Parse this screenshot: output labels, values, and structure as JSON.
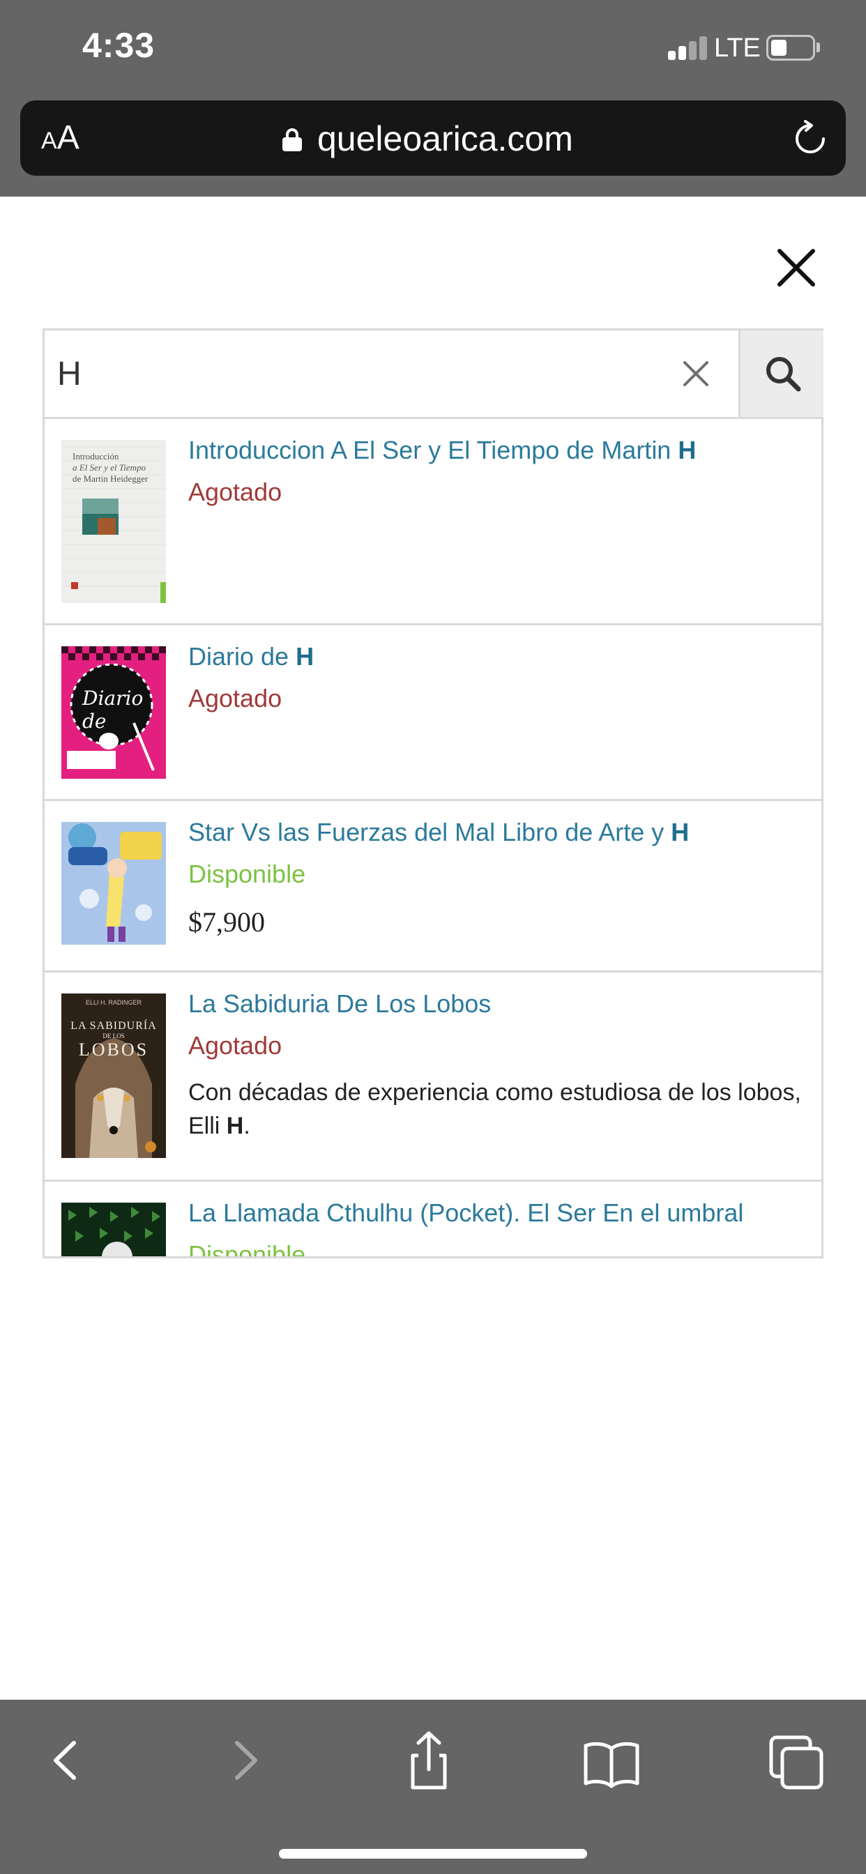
{
  "status_bar": {
    "time": "4:33",
    "network": "LTE",
    "icons": [
      "signal-icon",
      "battery-icon"
    ]
  },
  "browser": {
    "text_size_small": "A",
    "text_size_big": "A",
    "domain": "queleoarica.com",
    "icons": [
      "lock-icon",
      "reload-icon"
    ]
  },
  "search": {
    "value": "H",
    "placeholder": "",
    "icons": [
      "close-icon",
      "clear-icon",
      "search-icon"
    ]
  },
  "results": [
    {
      "title_prefix": "Introduccion A El Ser y El Tiempo de Martin ",
      "title_match": "H",
      "status": "Agotado",
      "cover_text_1": "Introducción",
      "cover_text_2": "a El Ser y el Tiempo",
      "cover_text_3": "de Martin Heidegger"
    },
    {
      "title_prefix": "Diario de ",
      "title_match": "H",
      "status": "Agotado",
      "cover_text": "Diario de"
    },
    {
      "title_prefix": "Star Vs las Fuerzas del Mal Libro de Arte y ",
      "title_match": "H",
      "status": "Disponible",
      "price": "$7,900"
    },
    {
      "title_prefix": "La Sabiduria De Los Lobos",
      "title_match": "",
      "status": "Agotado",
      "desc_prefix": " Con décadas de experiencia como estudiosa de los lobos, Elli ",
      "desc_match": "H",
      "desc_suffix": ".",
      "cover_author": "ELLI H. RADINGER",
      "cover_title_1": "LA SABIDURÍA",
      "cover_title_2": "DE LOS",
      "cover_title_3": "LOBOS"
    },
    {
      "title_prefix": "La Llamada Cthulhu (Pocket). El Ser En el umbral",
      "title_match": "",
      "status": "Disponible"
    }
  ],
  "colors": {
    "link": "#2b7a9b",
    "sold_out": "#a13a3a",
    "available": "#7cc241",
    "chrome": "#656565"
  },
  "toolbar": {
    "icons": [
      "back-icon",
      "forward-icon",
      "share-icon",
      "bookmarks-icon",
      "tabs-icon"
    ]
  }
}
